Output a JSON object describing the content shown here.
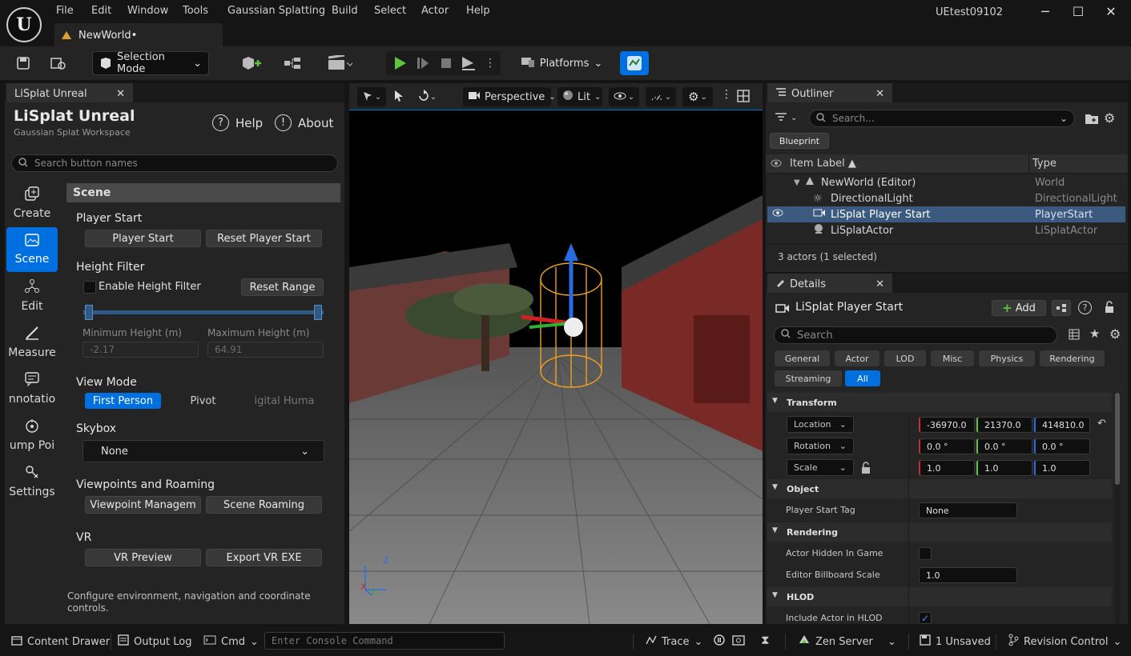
{
  "app": {
    "logo": "U",
    "project_name": "UEtest09102",
    "doc_tab": "NewWorld•"
  },
  "menu": [
    "File",
    "Edit",
    "Window",
    "Tools",
    "Gaussian Splatting",
    "Build",
    "Select",
    "Actor",
    "Help"
  ],
  "window_controls": {
    "minimize": "─",
    "maximize": "☐",
    "close": "✕"
  },
  "toolbar": {
    "selection_mode": "Selection Mode",
    "platforms": "Platforms"
  },
  "lisplat": {
    "tab_label": "LiSplat Unreal",
    "title": "LiSplat Unreal",
    "subtitle": "Gaussian Splat Workspace",
    "help": "Help",
    "about": "About",
    "search_placeholder": "Search button names",
    "nav": [
      {
        "label": "Create"
      },
      {
        "label": "Scene"
      },
      {
        "label": "Edit"
      },
      {
        "label": "Measure"
      },
      {
        "label": "nnotatio"
      },
      {
        "label": "ump Poi"
      },
      {
        "label": "Settings"
      }
    ],
    "section_header": "Scene",
    "player_start": {
      "title": "Player Start",
      "btn1": "Player Start",
      "btn2": "Reset Player Start"
    },
    "height_filter": {
      "title": "Height Filter",
      "enable": "Enable Height Filter",
      "reset": "Reset Range",
      "min_label": "Minimum Height (m)",
      "max_label": "Maximum Height (m)",
      "min_value": "-2.17",
      "max_value": "64.91"
    },
    "view_mode": {
      "title": "View Mode",
      "opt1": "First Person",
      "opt2": "Pivot",
      "opt3": "igital Huma"
    },
    "skybox": {
      "title": "Skybox",
      "value": "None"
    },
    "viewpoints": {
      "title": "Viewpoints and Roaming",
      "btn1": "Viewpoint Managem",
      "btn2": "Scene Roaming"
    },
    "vr": {
      "title": "VR",
      "btn1": "VR Preview",
      "btn2": "Export VR EXE"
    },
    "footer": "Configure environment, navigation and coordinate controls."
  },
  "viewport": {
    "perspective": "Perspective",
    "lit": "Lit",
    "axis_z": "Z",
    "axis_x": "X",
    "axis_y": "Y"
  },
  "outliner": {
    "tab_label": "Outliner",
    "search_placeholder": "Search...",
    "blueprint": "Blueprint",
    "col_label": "Item Label ▲",
    "col_type": "Type",
    "rows": [
      {
        "label": "NewWorld (Editor)",
        "type": "World"
      },
      {
        "label": "DirectionalLight",
        "type": "DirectionalLight"
      },
      {
        "label": "LiSplat Player Start",
        "type": "PlayerStart"
      },
      {
        "label": "LiSplatActor",
        "type": "LiSplatActor"
      }
    ],
    "status": "3 actors (1 selected)"
  },
  "details": {
    "tab_label": "Details",
    "actor_name": "LiSplat Player Start",
    "add": "Add",
    "search_placeholder": "Search",
    "filters": [
      "General",
      "Actor",
      "LOD",
      "Misc",
      "Physics",
      "Rendering",
      "Streaming",
      "All"
    ],
    "transform": {
      "title": "Transform",
      "location": {
        "label": "Location",
        "x": "-36970.0",
        "y": "21370.0",
        "z": "414810.0"
      },
      "rotation": {
        "label": "Rotation",
        "x": "0.0 °",
        "y": "0.0 °",
        "z": "0.0 °"
      },
      "scale": {
        "label": "Scale",
        "x": "1.0",
        "y": "1.0",
        "z": "1.0"
      }
    },
    "object": {
      "title": "Object",
      "tag_label": "Player Start Tag",
      "tag_value": "None"
    },
    "rendering": {
      "title": "Rendering",
      "hidden_label": "Actor Hidden In Game",
      "billboard_label": "Editor Billboard Scale",
      "billboard_value": "1.0"
    },
    "hlod": {
      "title": "HLOD",
      "include_label": "Include Actor in HLOD"
    }
  },
  "statusbar": {
    "content_drawer": "Content Drawer",
    "output_log": "Output Log",
    "cmd": "Cmd",
    "console_placeholder": "Enter Console Command",
    "trace": "Trace",
    "zen": "Zen Server",
    "unsaved": "1 Unsaved",
    "revision": "Revision Control"
  },
  "colors": {
    "accent": "#0070e0",
    "play": "#5ec43b",
    "bg": "#242424"
  }
}
